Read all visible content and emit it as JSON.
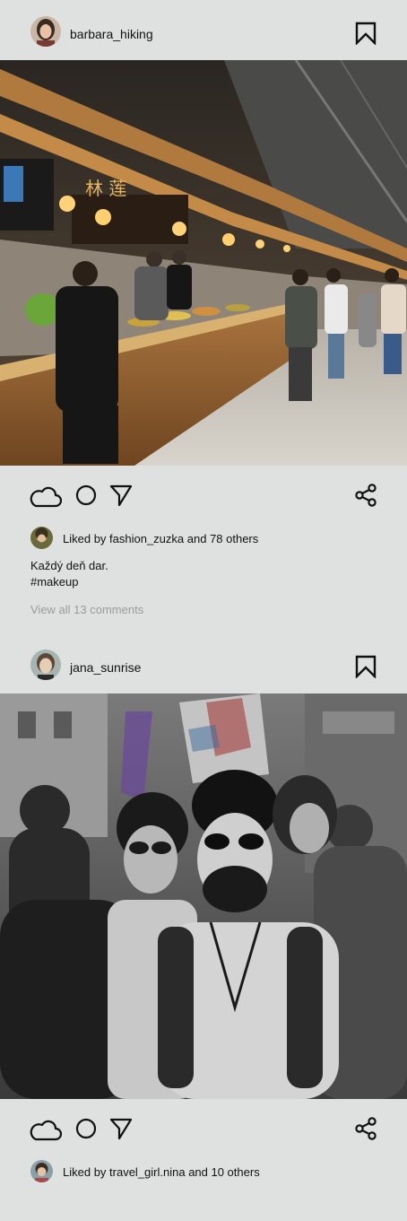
{
  "colors": {
    "background": "#dfe1e0",
    "text": "#111111",
    "muted": "#9a9c9b"
  },
  "posts": [
    {
      "username": "barbara_hiking",
      "image_icon": "food-court-photo",
      "liked_by": "Liked by fashion_zuzka and 78 others",
      "caption_line1": "Každý deň dar.",
      "caption_line2": "#makeup",
      "comments": "View all 13 comments"
    },
    {
      "username": "jana_sunrise",
      "image_icon": "street-parade-photo",
      "liked_by": "Liked by travel_girl.nina and 10 others"
    }
  ]
}
